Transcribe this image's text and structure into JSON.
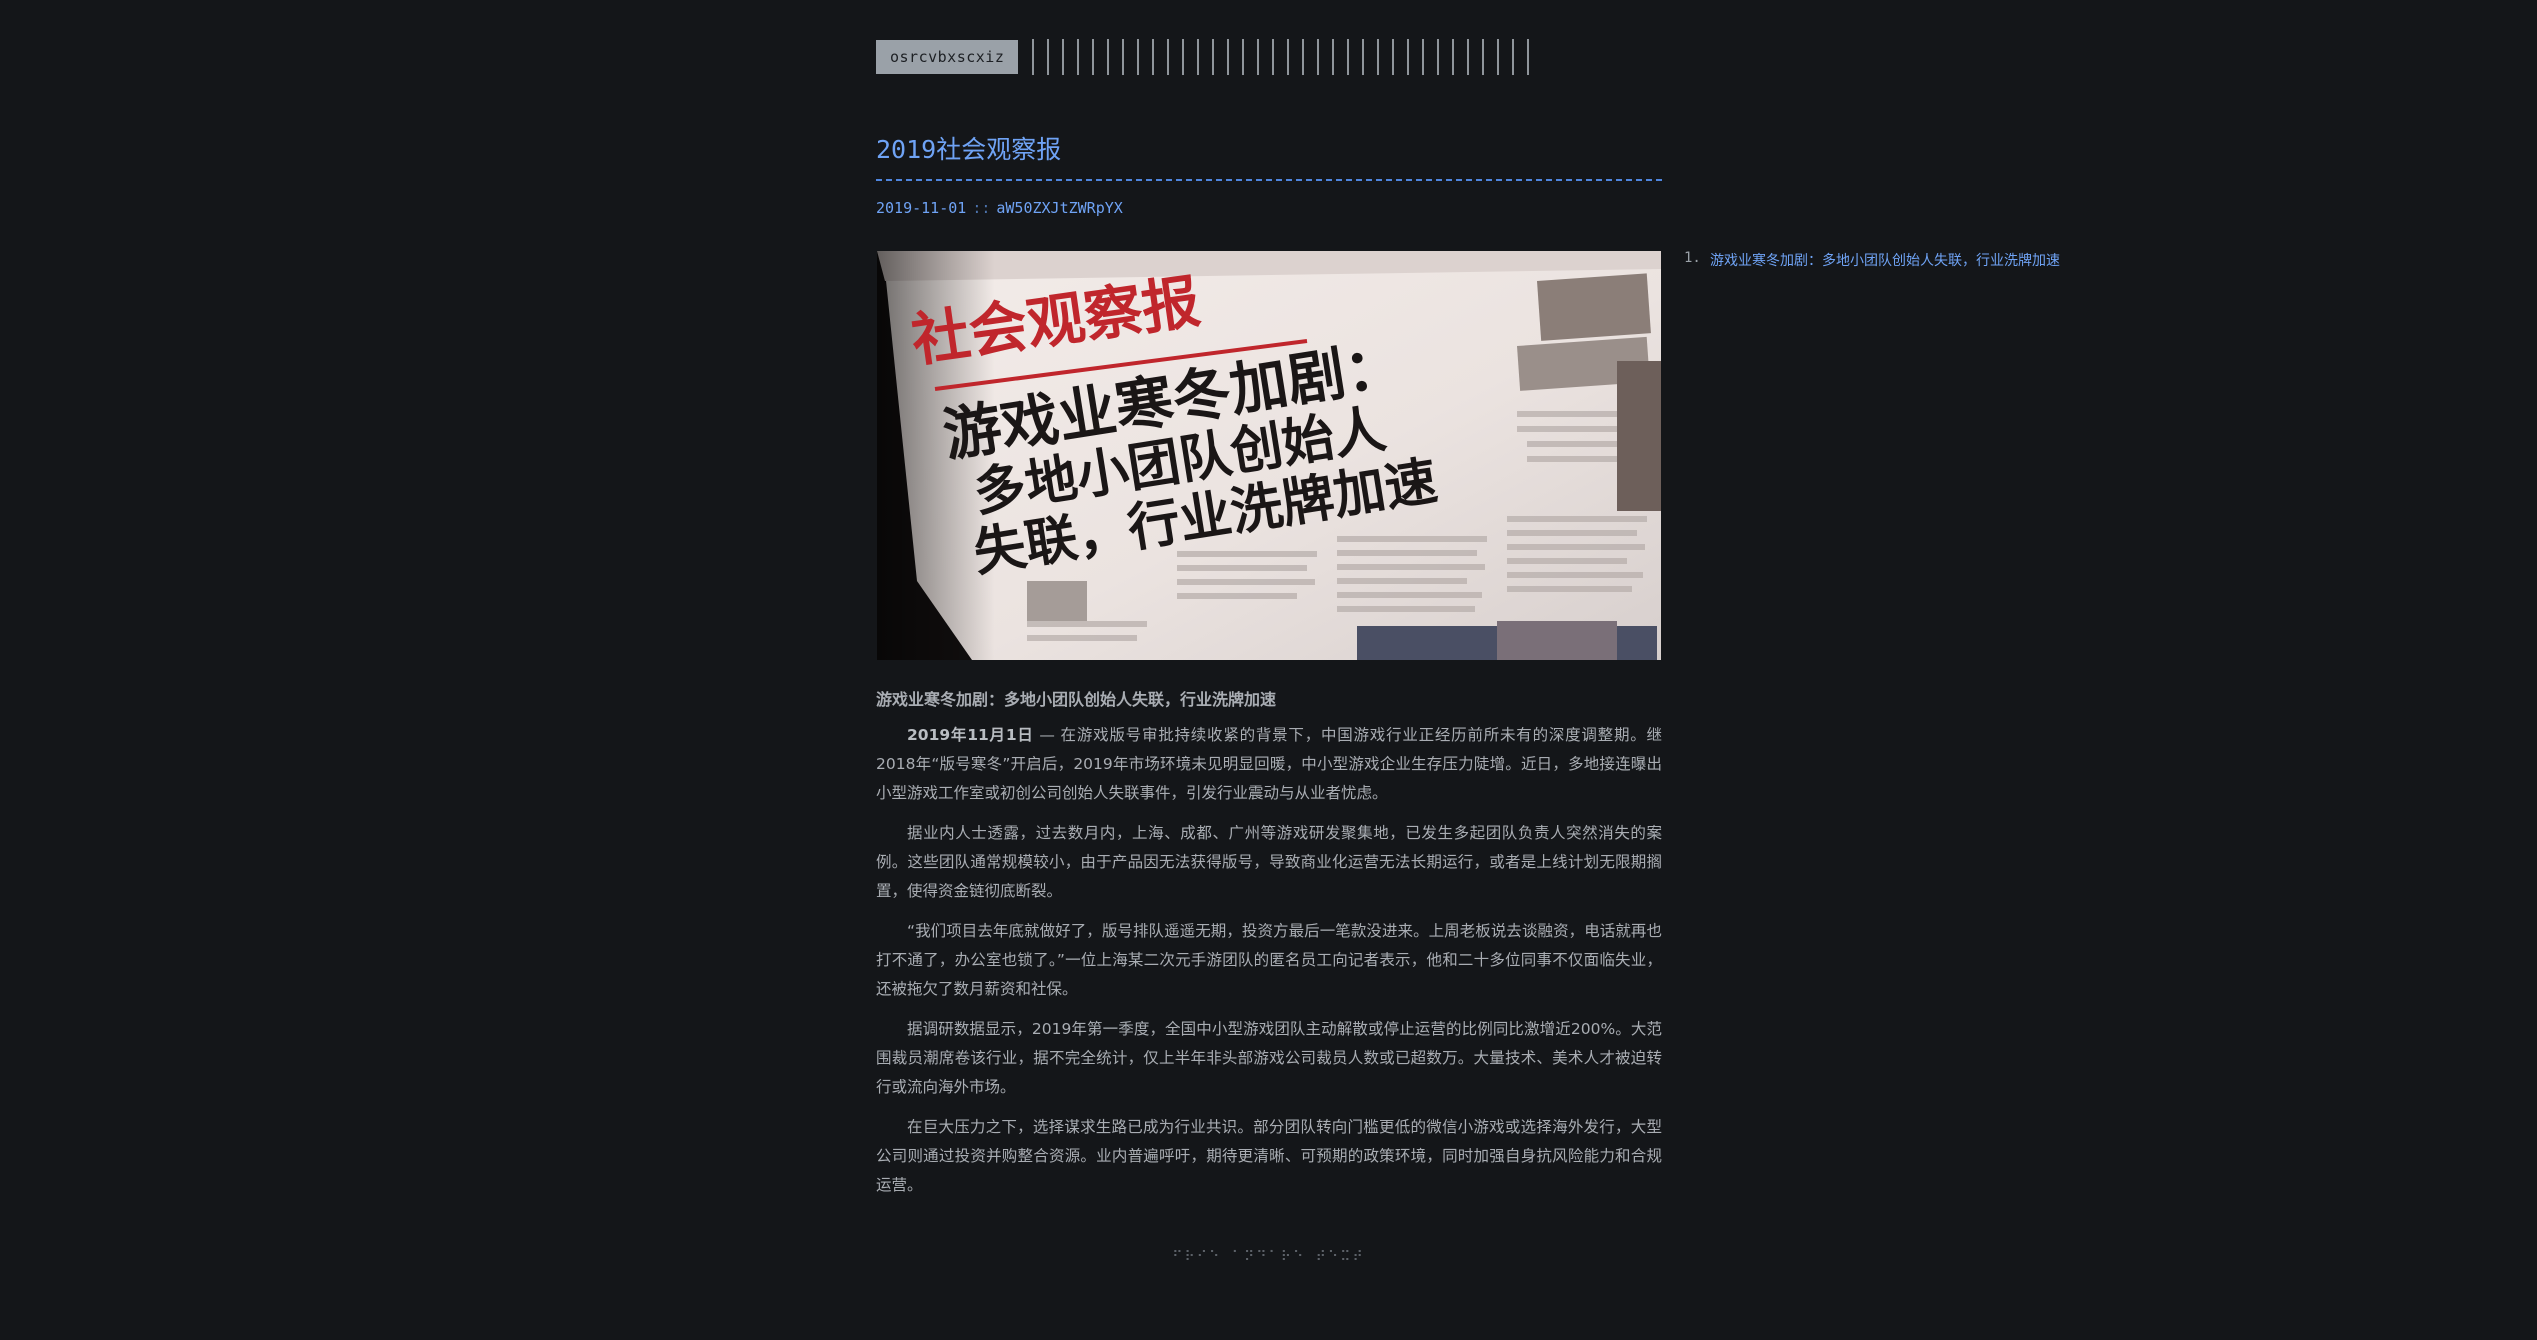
{
  "site": {
    "logo": "osrcvbxscxiz",
    "nav_item_count": 34
  },
  "post": {
    "title": "2019社会观察报",
    "date": "2019-11-01",
    "meta_separator": "::",
    "author": "aW50ZXJtZWRpYX"
  },
  "cover": {
    "masthead": "社会观察报",
    "headline_line1": "游戏业寒冬加剧：",
    "headline_line2": "多地小团队创始人",
    "headline_line3": "失联，行业洗牌加速"
  },
  "toc": {
    "items": [
      {
        "number": "1.",
        "label": "游戏业寒冬加剧：多地小团队创始人失联，行业洗牌加速"
      }
    ]
  },
  "article": {
    "heading": "游戏业寒冬加剧：多地小团队创始人失联，行业洗牌加速",
    "p1_lead": "2019年11月1日",
    "p1_rest": " — 在游戏版号审批持续收紧的背景下，中国游戏行业正经历前所未有的深度调整期。继2018年“版号寒冬”开启后，2019年市场环境未见明显回暖，中小型游戏企业生存压力陡增。近日，多地接连曝出小型游戏工作室或初创公司创始人失联事件，引发行业震动与从业者忧虑。",
    "p2": "据业内人士透露，过去数月内，上海、成都、广州等游戏研发聚集地，已发生多起团队负责人突然消失的案例。这些团队通常规模较小，由于产品因无法获得版号，导致商业化运营无法长期运行，或者是上线计划无限期搁置，使得资金链彻底断裂。",
    "p3": "“我们项目去年底就做好了，版号排队遥遥无期，投资方最后一笔款没进来。上周老板说去谈融资，电话就再也打不通了，办公室也锁了。”一位上海某二次元手游团队的匿名员工向记者表示，他和二十多位同事不仅面临失业，还被拖欠了数月薪资和社保。",
    "p4": "据调研数据显示，2019年第一季度，全国中小型游戏团队主动解散或停止运营的比例同比激增近200%。大范围裁员潮席卷该行业，据不完全统计，仅上半年非头部游戏公司裁员人数或已超数万。大量技术、美术人才被迫转行或流向海外市场。",
    "p5": "在巨大压力之下，选择谋求生路已成为行业共识。部分团队转向门槛更低的微信小游戏或选择海外发行，大型公司则通过投资并购整合资源。业内普遍呼吁，期待更清晰、可预期的政策环境，同时加强自身抗风险能力和合规运营。"
  },
  "footer": {
    "text": "⠋⠗⠊⠑ ⠁⠝⠙⠁⠗⠑ ⠞⠑⠭⠞"
  },
  "colors": {
    "background": "#141619",
    "accent": "#6fa3f5",
    "text": "#a9adb3",
    "logo_bg": "#9aa1a8"
  }
}
